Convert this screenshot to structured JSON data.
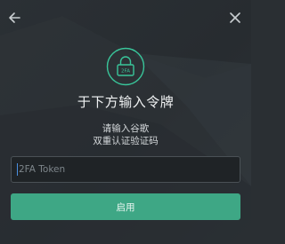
{
  "header": {
    "back_icon": "arrow-left-icon",
    "close_icon": "close-icon"
  },
  "lock": {
    "icon": "lock-icon",
    "badge": "2FA",
    "accent": "#39c59a"
  },
  "title": "于下方输入令牌",
  "subtitle": {
    "line1": "请输入谷歌",
    "line2": "双重认证验证码"
  },
  "token_input": {
    "placeholder": "2FA Token",
    "value": ""
  },
  "enable_button": {
    "label": "启用",
    "color": "#3ea785"
  }
}
